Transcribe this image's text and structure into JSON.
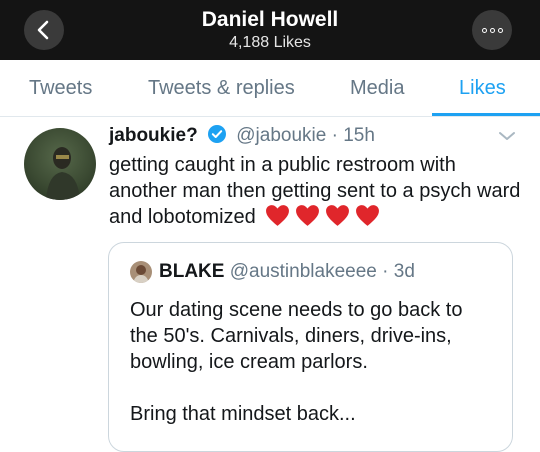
{
  "header": {
    "title": "Daniel Howell",
    "subtitle": "4,188 Likes"
  },
  "tabs": [
    {
      "label": "Tweets",
      "active": false
    },
    {
      "label": "Tweets & replies",
      "active": false
    },
    {
      "label": "Media",
      "active": false
    },
    {
      "label": "Likes",
      "active": true
    }
  ],
  "tweet": {
    "author_name": "jaboukie?",
    "handle": "@jaboukie",
    "separator": "·",
    "time": "15h",
    "text": "getting caught in a public restroom with another man then getting sent to a psych ward and lobotomized",
    "heart_count": 4,
    "quote": {
      "author_name": "BLAKE",
      "handle": "@austinblakeeee",
      "separator": "·",
      "time": "3d",
      "lines": [
        "Our dating scene needs to go back to",
        "the 50's. Carnivals, diners, drive-ins,",
        "bowling, ice cream parlors.",
        "",
        "Bring that mindset back..."
      ]
    }
  },
  "icons": {
    "back": "chevron-left-icon",
    "more": "more-horizontal-icon",
    "verified": "verified-badge-icon",
    "caret": "chevron-down-icon",
    "heart": "red-heart-emoji"
  },
  "colors": {
    "accent": "#1da1f2",
    "topbar": "#141414",
    "heart": "#e0262b",
    "secondary_text": "#657786"
  }
}
